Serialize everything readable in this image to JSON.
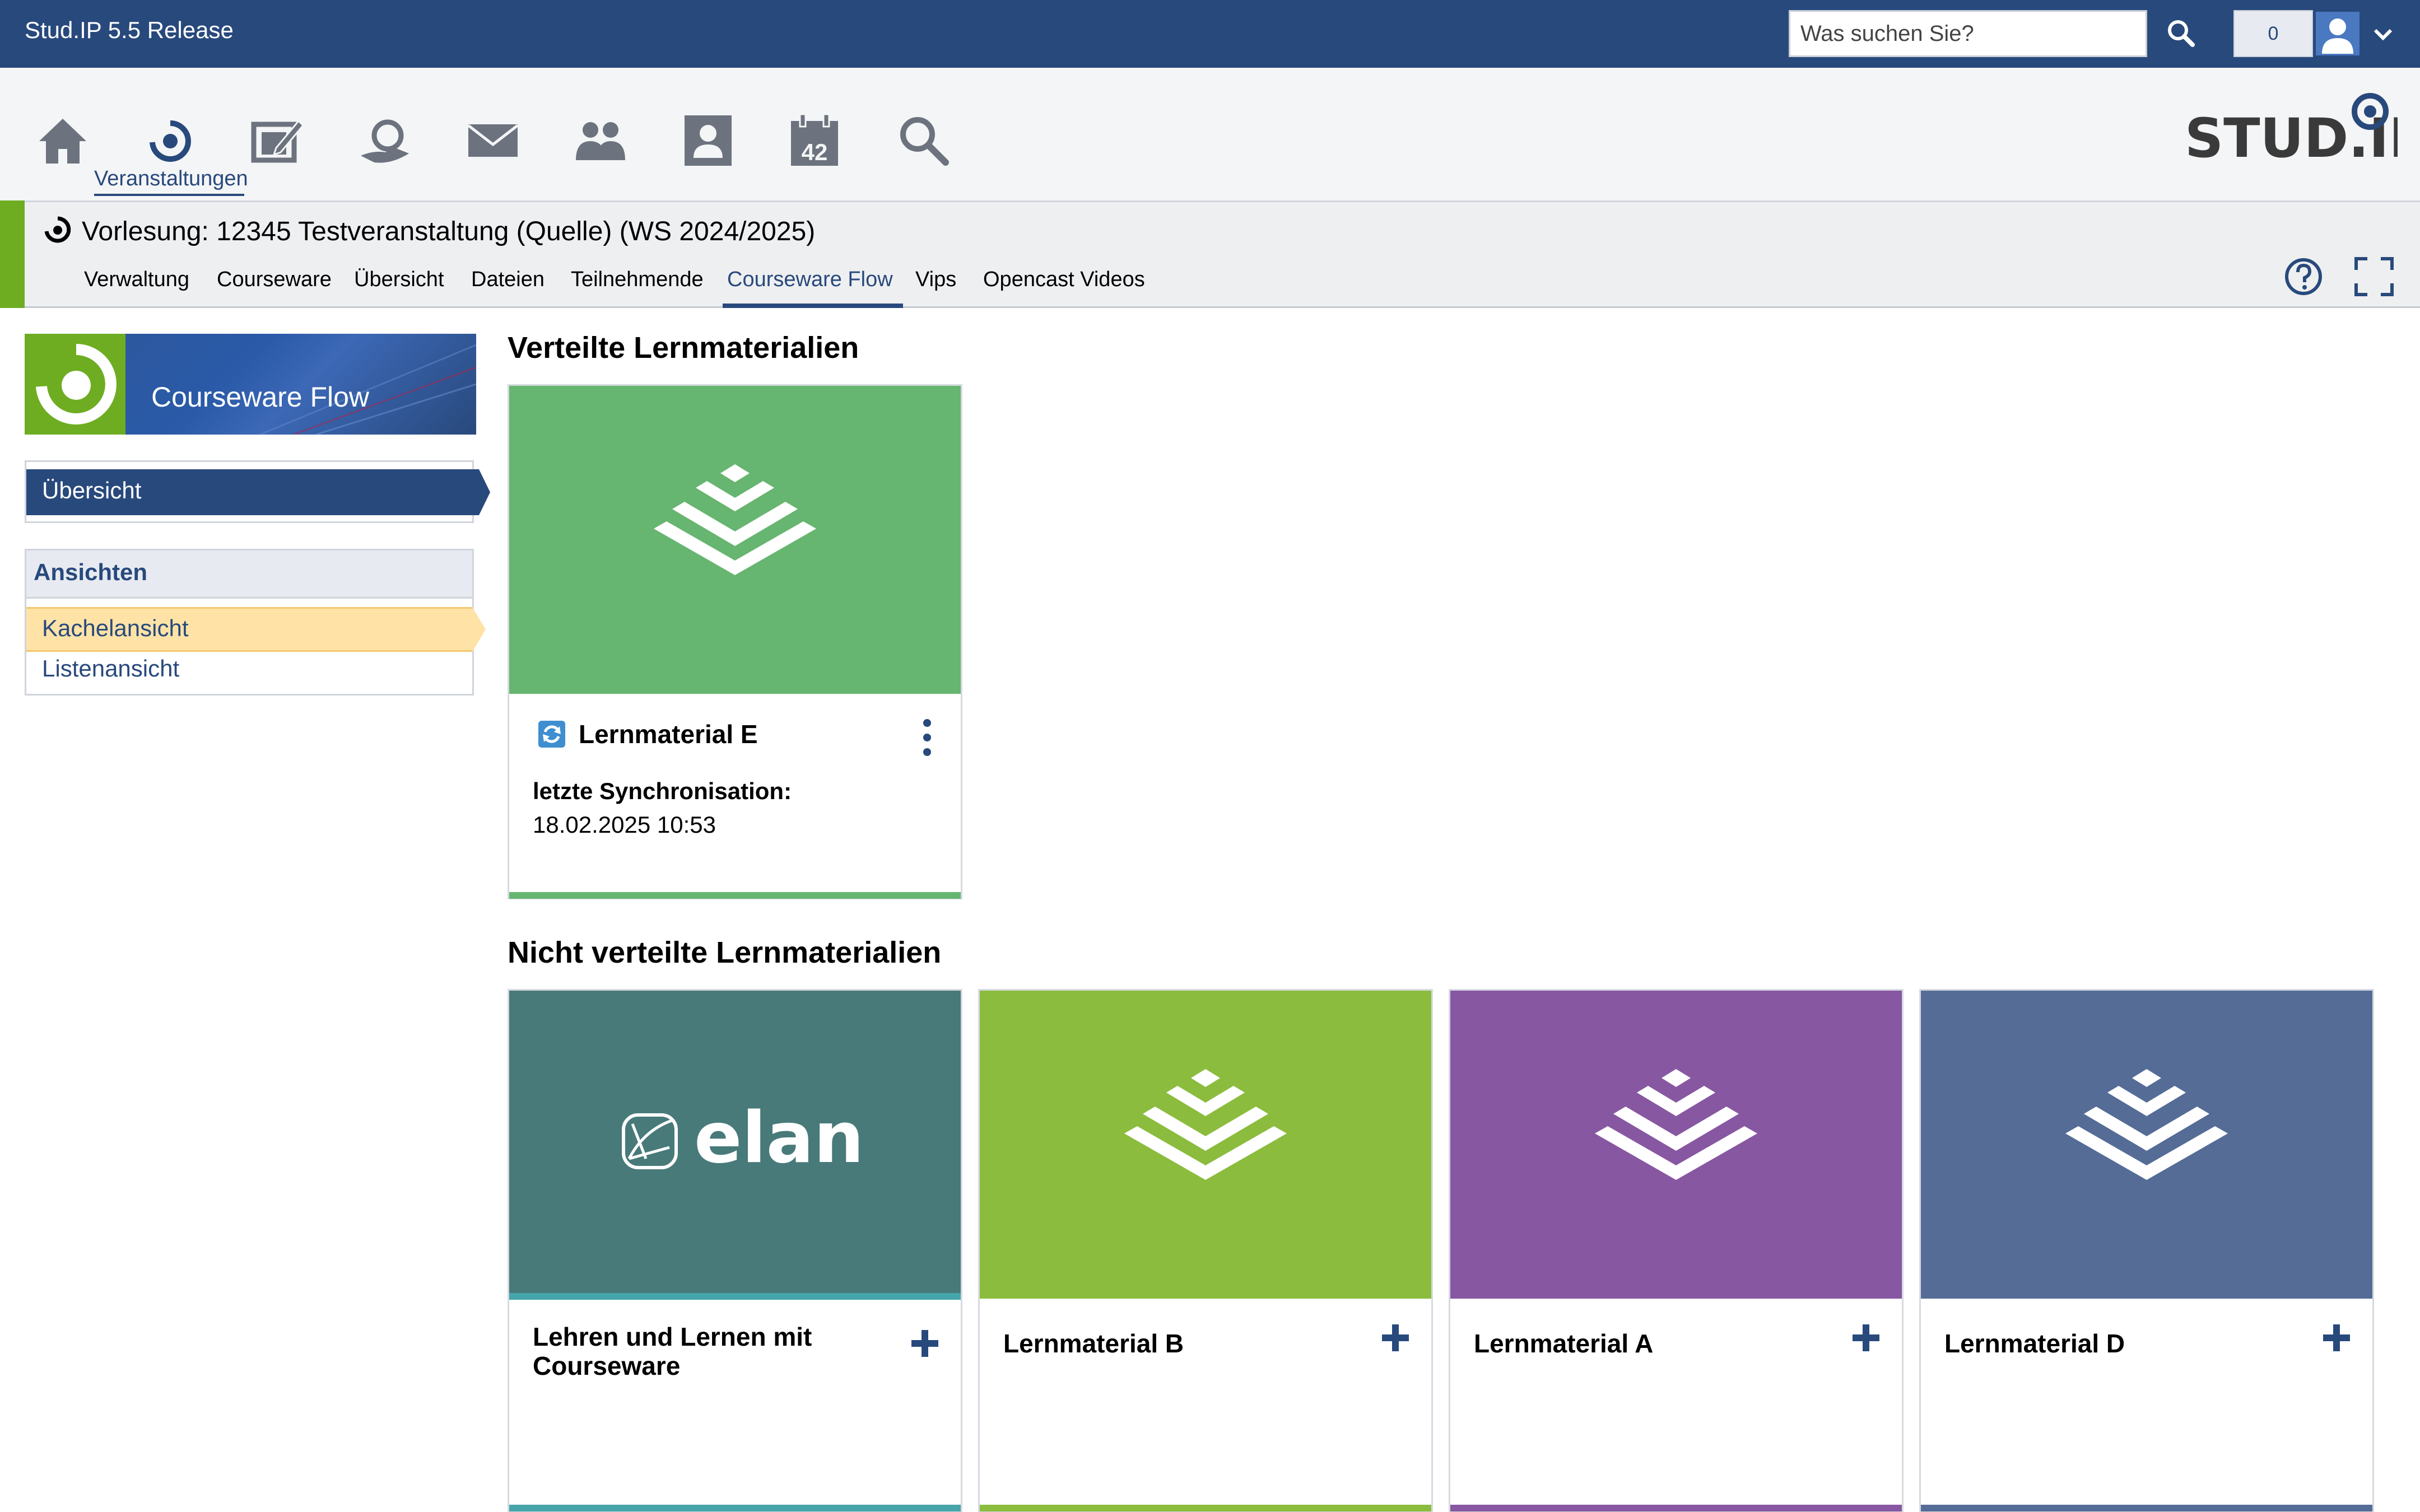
{
  "topbar": {
    "release_label": "Stud.IP 5.5 Release",
    "search_placeholder": "Was suchen Sie?",
    "notification_count": "0"
  },
  "nav": {
    "items": [
      {
        "icon": "home-icon"
      },
      {
        "icon": "courses-icon",
        "label": "Veranstaltungen",
        "active": true
      },
      {
        "icon": "workplace-icon"
      },
      {
        "icon": "community-icon"
      },
      {
        "icon": "mail-icon"
      },
      {
        "icon": "contacts-icon"
      },
      {
        "icon": "profile-icon"
      },
      {
        "icon": "calendar-icon",
        "calendar_number": "42"
      },
      {
        "icon": "search-icon"
      }
    ],
    "brand": "STUD.IP"
  },
  "context": {
    "title": "Vorlesung: 12345 Testveranstaltung (Quelle) (WS 2024/2025)",
    "tabs": [
      "Verwaltung",
      "Courseware",
      "Übersicht",
      "Dateien",
      "Teilnehmende",
      "Courseware Flow",
      "Vips",
      "Opencast Videos"
    ],
    "active_tab": "Courseware Flow"
  },
  "sidebar": {
    "header": "Courseware Flow",
    "nav_item": "Übersicht",
    "views_title": "Ansichten",
    "views": [
      "Kachelansicht",
      "Listenansicht"
    ],
    "active_view": "Kachelansicht"
  },
  "main": {
    "distributed_heading": "Verteilte Lernmaterialien",
    "distributed": [
      {
        "title": "Lernmaterial E",
        "sync_label": "letzte Synchronisation:",
        "sync_date": "18.02.2025 10:53",
        "color": "#66b570"
      }
    ],
    "undistributed_heading": "Nicht verteilte Lernmaterialien",
    "undistributed": [
      {
        "title": "Lehren und Lernen mit Courseware",
        "color": "#487a7a",
        "image_text": "elan",
        "bottom_color": "#45a5aa"
      },
      {
        "title": "Lernmaterial B",
        "color": "#8bbc3e",
        "bottom_color": "#8bbc3e"
      },
      {
        "title": "Lernmaterial A",
        "color": "#8757a2",
        "bottom_color": "#8757a2"
      },
      {
        "title": "Lernmaterial D",
        "color": "#546c96",
        "bottom_color": "#546c96"
      }
    ]
  }
}
